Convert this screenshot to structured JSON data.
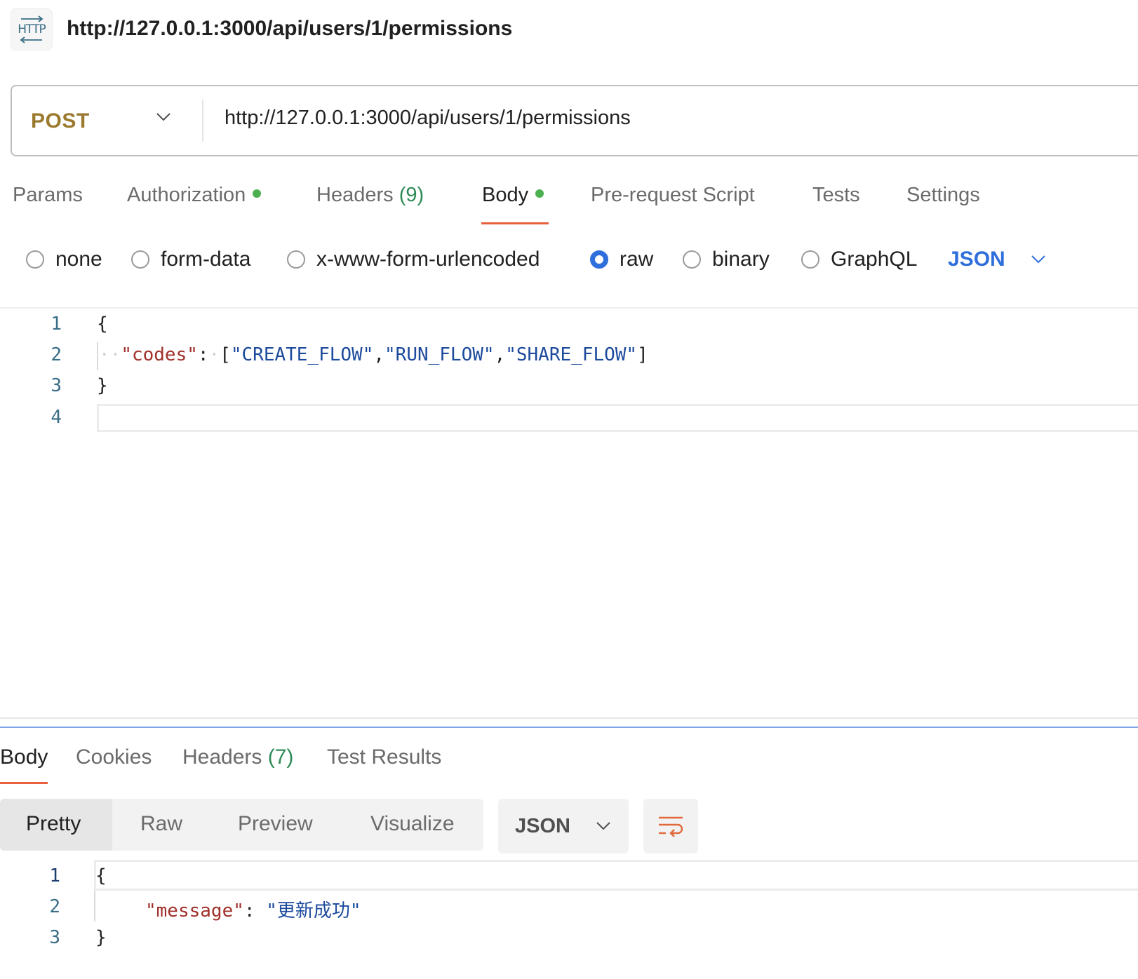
{
  "header": {
    "badge_text": "HTTP",
    "title": "http://127.0.0.1:3000/api/users/1/permissions"
  },
  "request": {
    "method": "POST",
    "url": "http://127.0.0.1:3000/api/users/1/permissions",
    "tabs": [
      {
        "label": "Params"
      },
      {
        "label": "Authorization",
        "dot": true
      },
      {
        "label": "Headers",
        "count": "(9)"
      },
      {
        "label": "Body",
        "dot": true,
        "active": true
      },
      {
        "label": "Pre-request Script"
      },
      {
        "label": "Tests"
      },
      {
        "label": "Settings"
      }
    ],
    "body_types": [
      {
        "label": "none",
        "checked": false
      },
      {
        "label": "form-data",
        "checked": false
      },
      {
        "label": "x-www-form-urlencoded",
        "checked": false
      },
      {
        "label": "raw",
        "checked": true
      },
      {
        "label": "binary",
        "checked": false
      },
      {
        "label": "GraphQL",
        "checked": false
      }
    ],
    "language": "JSON",
    "editor": {
      "line_numbers": [
        "1",
        "2",
        "3",
        "4"
      ],
      "open_brace": "{",
      "key": "\"codes\"",
      "colon": ":",
      "bracket_open": "[",
      "values": [
        "\"CREATE_FLOW\"",
        "\"RUN_FLOW\"",
        "\"SHARE_FLOW\""
      ],
      "comma": ",",
      "bracket_close": "]",
      "close_brace": "}"
    }
  },
  "response": {
    "tabs": [
      {
        "label": "Body",
        "active": true
      },
      {
        "label": "Cookies"
      },
      {
        "label": "Headers",
        "count": "(7)"
      },
      {
        "label": "Test Results"
      }
    ],
    "views": [
      "Pretty",
      "Raw",
      "Preview",
      "Visualize"
    ],
    "active_view": "Pretty",
    "language": "JSON",
    "editor": {
      "line_numbers": [
        "1",
        "2",
        "3"
      ],
      "open_brace": "{",
      "key": "\"message\"",
      "colon": ":",
      "value": "\"更新成功\"",
      "close_brace": "}"
    }
  },
  "colors": {
    "method": "#9b7a2f",
    "accent_blue": "#2f6fdc",
    "active_tab_underline": "#e8603c",
    "dot_green": "#4caf50",
    "json_key": "#a0302a",
    "json_string": "#1c4a9c"
  },
  "icons": [
    "http-icon",
    "chevron-down-icon",
    "wrap-lines-icon"
  ]
}
